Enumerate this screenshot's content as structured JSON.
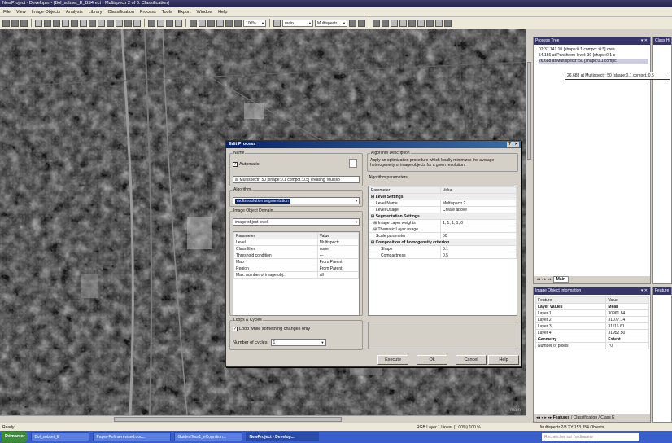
{
  "window_title": "NewProject - Developer - [Bol_subset_E_BS4rect - Multispectr 2 of 3: Classification]",
  "menu": [
    "File",
    "View",
    "Image Objects",
    "Analysis",
    "Library",
    "Classification",
    "Process",
    "Tools",
    "Export",
    "Window",
    "Help"
  ],
  "toolbar": {
    "zoom": "100%",
    "level_a": "main",
    "level_b": "Multispectr"
  },
  "process_tree": {
    "title": "Process Tree",
    "items": [
      "07:37.141  10 [shape:0.1 compct.:0.5] crea",
      "54.156  at Panchrom-level: 30 [shape:0.1 c",
      "26.688  at Multispectr: 50 [shape:0.1 compc"
    ],
    "tooltip": "26.688  at Multispectr: 50 [shape:0.1 compct.:0.5",
    "tab": "Main"
  },
  "class_hierarchy_title": "Class Hi",
  "feature_panel_title": "Feature",
  "image_object_info": {
    "title": "Image Object Information",
    "headers": [
      "Feature",
      "Value"
    ],
    "rows": [
      [
        "Layer Values",
        "Mean"
      ],
      [
        "Layer 1",
        "30961.84"
      ],
      [
        "Layer 2",
        "31077.14"
      ],
      [
        "Layer 3",
        "31116.61"
      ],
      [
        "Layer 4",
        "31952.50"
      ],
      [
        "Geometry",
        "Extent"
      ],
      [
        "Number of pixels",
        "70"
      ]
    ],
    "tabs": [
      "Features",
      "Classification",
      "Class E"
    ]
  },
  "map_label": "main",
  "dialog": {
    "title": "Edit Process",
    "name_legend": "Name",
    "automatic": "Automatic",
    "name_value": "at Multispectr: 50 [shape:0.1 compct.:0.5] creating 'Multisp",
    "algorithm_legend": "Algorithm",
    "algorithm_value": "multiresolution segmentation",
    "domain_legend": "Image Object Domain",
    "domain_value": "image object level",
    "domain_headers": [
      "Parameter",
      "Value"
    ],
    "domain_rows": [
      [
        "Level",
        "Multispectr"
      ],
      [
        "Class filter",
        "none"
      ],
      [
        "Threshold condition",
        "---"
      ],
      [
        "Map",
        "From Parent"
      ],
      [
        "Region",
        "From Parent"
      ],
      [
        "Max. number of image obj...",
        "all"
      ]
    ],
    "loops_legend": "Loops & Cycles",
    "loop_label": "Loop while something changes only",
    "cycles_label": "Number of cycles",
    "cycles_value": "1",
    "desc_legend": "Algorithm Description",
    "desc_text": "Apply an optimization procedure which locally minimizes the average heterogeneity of image objects for a given resolution.",
    "params_label": "Algorithm parameters",
    "param_headers": [
      "Parameter",
      "Value"
    ],
    "param_rows": [
      [
        "Level Settings",
        ""
      ],
      [
        "Level Name",
        "Multispectr 2"
      ],
      [
        "Level Usage",
        "Create above"
      ],
      [
        "Segmentation Settings",
        ""
      ],
      [
        "Image Layer weights",
        "1, 1, 1, 1, 0"
      ],
      [
        "Thematic Layer usage",
        ""
      ],
      [
        "Scale parameter",
        "50"
      ],
      [
        "Composition of homogeneity criterion",
        ""
      ],
      [
        "Shape",
        "0.1"
      ],
      [
        "Compactness",
        "0.5"
      ]
    ],
    "buttons": [
      "Execute",
      "Ok",
      "Cancel",
      "Help"
    ]
  },
  "status": {
    "left": "Ready",
    "mid": "RGB  Layer 1  Linear (1.00%)  100 %",
    "right": "Multispectr 2/3    XY    153,354 Objects"
  },
  "taskbar": {
    "start": "Démarrer",
    "tasks": [
      "Bol_subset_E",
      "Paper-Polina-revised.doc...",
      "GuidedTour1_eCognition...",
      "NewProject - Develop..."
    ],
    "search": "Rechercher sur l'ordinateur"
  }
}
